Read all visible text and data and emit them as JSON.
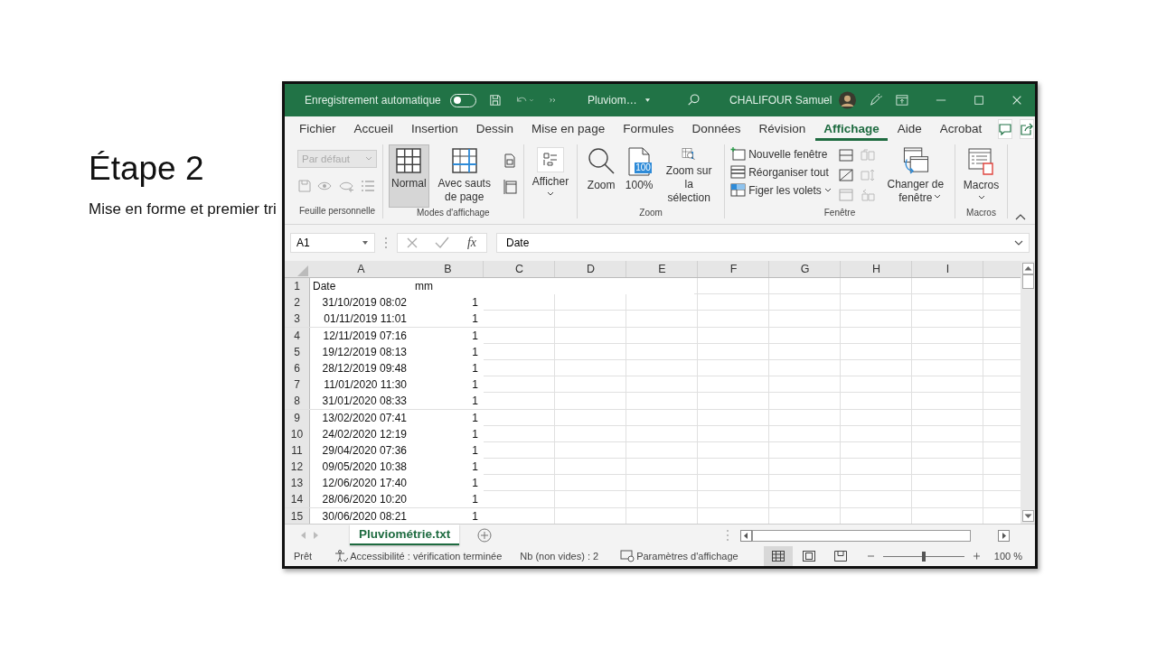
{
  "slide": {
    "title": "Étape 2",
    "subtitle": "Mise en forme et premier tri"
  },
  "title_bar": {
    "autosave_label": "Enregistrement automatique",
    "autosave_on": false,
    "file_name": "Pluviom…",
    "user": "CHALIFOUR Samuel"
  },
  "tabs": [
    {
      "label": "Fichier",
      "selected": false
    },
    {
      "label": "Accueil",
      "selected": false
    },
    {
      "label": "Insertion",
      "selected": false
    },
    {
      "label": "Dessin",
      "selected": false
    },
    {
      "label": "Mise en page",
      "selected": false
    },
    {
      "label": "Formules",
      "selected": false
    },
    {
      "label": "Données",
      "selected": false
    },
    {
      "label": "Révision",
      "selected": false
    },
    {
      "label": "Affichage",
      "selected": true
    },
    {
      "label": "Aide",
      "selected": false
    },
    {
      "label": "Acrobat",
      "selected": false
    }
  ],
  "ribbon": {
    "personal_sheet": {
      "label": "Feuille personnelle",
      "dropdown": "Par défaut",
      "disabled": true
    },
    "view_modes": {
      "label": "Modes d'affichage",
      "buttons": [
        {
          "kind": "normal",
          "label": "Normal",
          "selected": true
        },
        {
          "kind": "page_break",
          "label": "Avec sauts de page",
          "selected": false
        }
      ]
    },
    "show": {
      "label": "Afficher"
    },
    "zoom": {
      "label": "Zoom",
      "buttons": [
        {
          "kind": "zoom",
          "label": "Zoom"
        },
        {
          "kind": "hundred",
          "label": "100%",
          "icon_text": "100"
        },
        {
          "kind": "selection",
          "label": "Zoom sur la sélection"
        }
      ]
    },
    "window": {
      "label": "Fenêtre",
      "commands": [
        {
          "kind": "new",
          "label": "Nouvelle fenêtre"
        },
        {
          "kind": "arrange",
          "label": "Réorganiser tout"
        },
        {
          "kind": "freeze",
          "label": "Figer les volets"
        }
      ],
      "switch": "Changer de fenêtre"
    },
    "macros": {
      "label": "Macros",
      "button": "Macros"
    }
  },
  "formula_bar": {
    "name_box": "A1",
    "function_label": "fx",
    "content": "Date"
  },
  "grid": {
    "columns": [
      "A",
      "B",
      "C",
      "D",
      "E",
      "F",
      "G",
      "H",
      "I"
    ],
    "rows": [
      {
        "num": "1",
        "a": "Date",
        "b": "mm",
        "kind": "text"
      },
      {
        "num": "2",
        "a": "31/10/2019 08:02",
        "b": "1",
        "kind": "number"
      },
      {
        "num": "3",
        "a": "01/11/2019 11:01",
        "b": "1",
        "kind": "number"
      },
      {
        "num": "4",
        "a": "12/11/2019 07:16",
        "b": "1",
        "kind": "number"
      },
      {
        "num": "5",
        "a": "19/12/2019 08:13",
        "b": "1",
        "kind": "number"
      },
      {
        "num": "6",
        "a": "28/12/2019 09:48",
        "b": "1",
        "kind": "number"
      },
      {
        "num": "7",
        "a": "11/01/2020 11:30",
        "b": "1",
        "kind": "number"
      },
      {
        "num": "8",
        "a": "31/01/2020 08:33",
        "b": "1",
        "kind": "number"
      },
      {
        "num": "9",
        "a": "13/02/2020 07:41",
        "b": "1",
        "kind": "number"
      },
      {
        "num": "10",
        "a": "24/02/2020 12:19",
        "b": "1",
        "kind": "number"
      },
      {
        "num": "11",
        "a": "29/04/2020 07:36",
        "b": "1",
        "kind": "number"
      },
      {
        "num": "12",
        "a": "09/05/2020 10:38",
        "b": "1",
        "kind": "number"
      },
      {
        "num": "13",
        "a": "12/06/2020 17:40",
        "b": "1",
        "kind": "number"
      },
      {
        "num": "14",
        "a": "28/06/2020 10:20",
        "b": "1",
        "kind": "number"
      },
      {
        "num": "15",
        "a": "30/06/2020 08:21",
        "b": "1",
        "kind": "number"
      }
    ]
  },
  "sheet_tabs": [
    {
      "label": "Pluviométrie.txt",
      "selected": true
    }
  ],
  "status_bar": {
    "ready": "Prêt",
    "accessibility": "Accessibilité : vérification terminée",
    "count": "Nb (non vides) : 2",
    "display_settings": "Paramètres d'affichage",
    "views": [
      {
        "kind": "normal",
        "selected": true
      },
      {
        "kind": "layout",
        "selected": false
      },
      {
        "kind": "page_break",
        "selected": false
      }
    ],
    "zoom_slider": {
      "level": 0.5
    },
    "zoom": "100 %"
  }
}
